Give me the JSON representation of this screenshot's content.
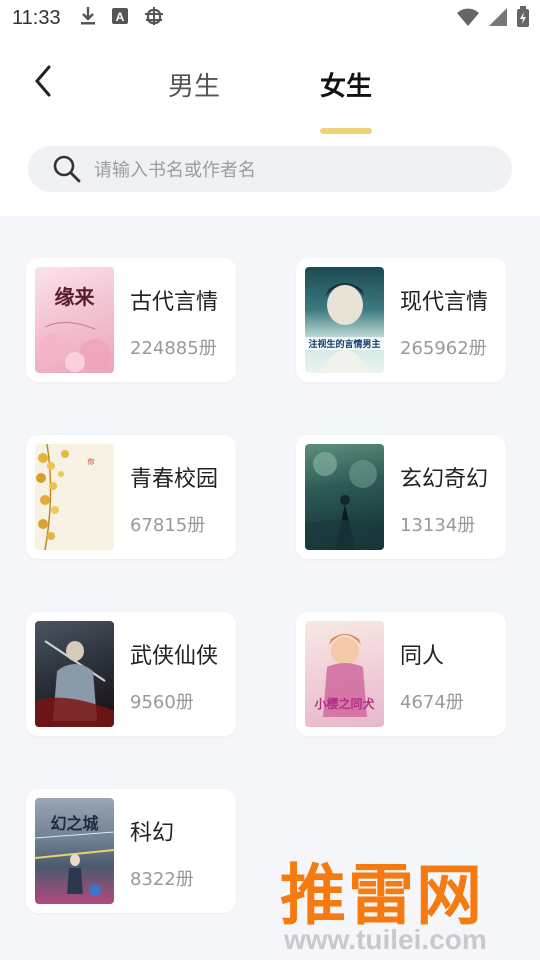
{
  "status_bar": {
    "time": "11:33"
  },
  "header": {
    "tabs": [
      {
        "label": "男生",
        "active": false
      },
      {
        "label": "女生",
        "active": true
      }
    ],
    "accent_color": "#efd27a"
  },
  "search": {
    "placeholder": "请输入书名或作者名"
  },
  "categories": [
    {
      "name": "古代言情",
      "count": "224885册",
      "cover_icon": "cover-ancient-romance",
      "cover_text": "缘来"
    },
    {
      "name": "现代言情",
      "count": "265962册",
      "cover_icon": "cover-modern-romance",
      "cover_text": "注视生的言情男主"
    },
    {
      "name": "青春校园",
      "count": "67815册",
      "cover_icon": "cover-youth-campus",
      "cover_text": ""
    },
    {
      "name": "玄幻奇幻",
      "count": "13134册",
      "cover_icon": "cover-fantasy",
      "cover_text": ""
    },
    {
      "name": "武侠仙侠",
      "count": "9560册",
      "cover_icon": "cover-wuxia",
      "cover_text": ""
    },
    {
      "name": "同人",
      "count": "4674册",
      "cover_icon": "cover-fanfic",
      "cover_text": "小樱之同犬"
    },
    {
      "name": "科幻",
      "count": "8322册",
      "cover_icon": "cover-scifi",
      "cover_text": "幻之城"
    }
  ],
  "watermark": {
    "main": "推雷网",
    "url": "www.tuilei.com"
  }
}
